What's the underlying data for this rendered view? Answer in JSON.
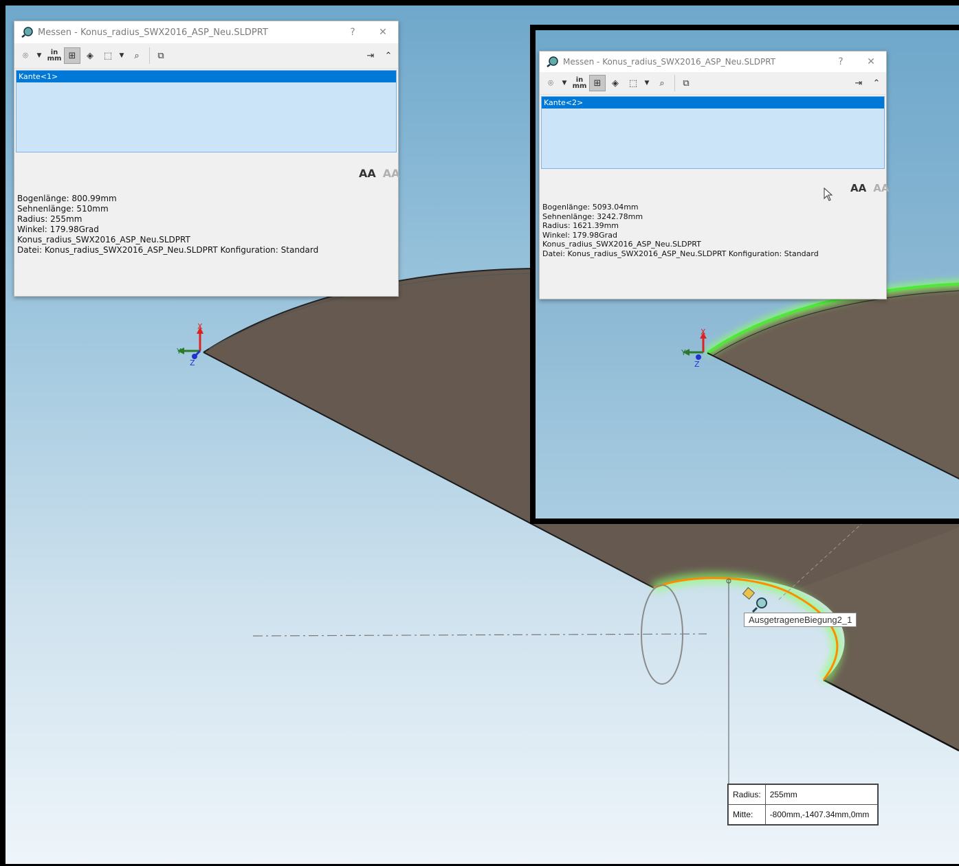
{
  "dialog_main": {
    "title": "Messen - Konus_radius_SWX2016_ASP_Neu.SLDPRT",
    "help": "?",
    "close": "✕",
    "unit_top": "in",
    "unit_bottom": "mm",
    "selection": "Kante<1>",
    "results": [
      "Bogenlänge: 800.99mm",
      "Sehnenlänge: 510mm",
      "Radius: 255mm",
      "Winkel: 179.98Grad",
      "Konus_radius_SWX2016_ASP_Neu.SLDPRT",
      "Datei: Konus_radius_SWX2016_ASP_Neu.SLDPRT Konfiguration: Standard"
    ]
  },
  "dialog_inset": {
    "title": "Messen - Konus_radius_SWX2016_ASP_Neu.SLDPRT",
    "help": "?",
    "close": "✕",
    "unit_top": "in",
    "unit_bottom": "mm",
    "selection": "Kante<2>",
    "results": [
      "Bogenlänge: 5093.04mm",
      "Sehnenlänge: 3242.78mm",
      "Radius: 1621.39mm",
      "Winkel: 179.98Grad",
      "Konus_radius_SWX2016_ASP_Neu.SLDPRT",
      "Datei: Konus_radius_SWX2016_ASP_Neu.SLDPRT Konfiguration: Standard"
    ]
  },
  "font_buttons": {
    "increase": "AA",
    "decrease": "AA"
  },
  "triad": {
    "x": "X",
    "y": "Y",
    "z": "Z"
  },
  "tag_label": "AusgetrageneBiegung2_1",
  "callout": {
    "radius_label": "Radius:",
    "radius_value": "255mm",
    "center_label": "Mitte:",
    "center_value": "-800mm,-1407.34mm,0mm"
  },
  "colors": {
    "part_face": "#6b5f53",
    "highlight_edge": "#ff8c00",
    "glow": "#7dff5a",
    "selection": "#0078d7",
    "list_bg": "#cce4f7"
  }
}
